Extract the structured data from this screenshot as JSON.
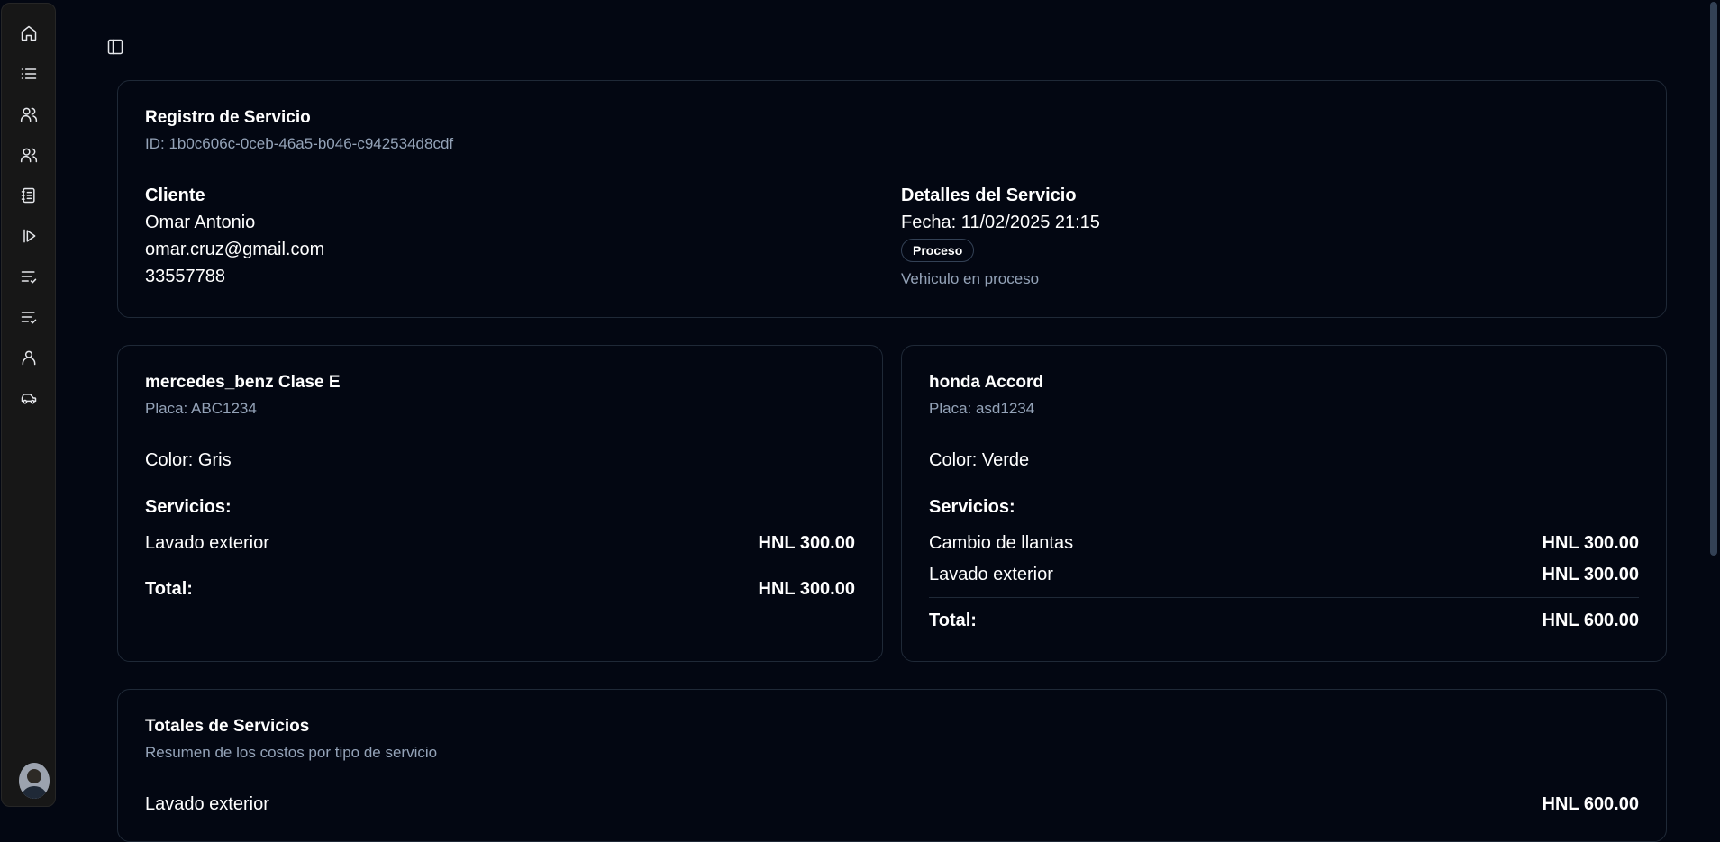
{
  "header": {
    "title": "Registro de Servicio",
    "id_text": "ID: 1b0c606c-0ceb-46a5-b046-c942534d8cdf"
  },
  "client": {
    "heading": "Cliente",
    "name": "Omar Antonio",
    "email": "omar.cruz@gmail.com",
    "phone": "33557788"
  },
  "details": {
    "heading": "Detalles del Servicio",
    "date": "Fecha: 11/02/2025 21:15",
    "badge": "Proceso",
    "status_text": "Vehiculo en proceso"
  },
  "vehicles": [
    {
      "name": "mercedes_benz Clase E",
      "plate": "Placa: ABC1234",
      "color": "Color: Gris",
      "services_label": "Servicios:",
      "services": [
        {
          "name": "Lavado exterior",
          "price": "HNL 300.00"
        }
      ],
      "total_label": "Total:",
      "total": "HNL 300.00"
    },
    {
      "name": "honda Accord",
      "plate": "Placa: asd1234",
      "color": "Color: Verde",
      "services_label": "Servicios:",
      "services": [
        {
          "name": "Cambio de llantas",
          "price": "HNL 300.00"
        },
        {
          "name": "Lavado exterior",
          "price": "HNL 300.00"
        }
      ],
      "total_label": "Total:",
      "total": "HNL 600.00"
    }
  ],
  "totals": {
    "title": "Totales de Servicios",
    "subtitle": "Resumen de los costos por tipo de servicio",
    "rows": [
      {
        "name": "Lavado exterior",
        "price": "HNL 600.00"
      }
    ]
  },
  "sidebar_icons": [
    "home-icon",
    "list-icon",
    "users-icon",
    "users-icon",
    "notebook-icon",
    "play-icon",
    "list-check-icon",
    "list-check-icon",
    "user-icon",
    "car-icon"
  ],
  "colors": {
    "background": "#030712",
    "sidebar": "#171717",
    "border": "#1f2937",
    "muted_text": "#94a3b8"
  }
}
